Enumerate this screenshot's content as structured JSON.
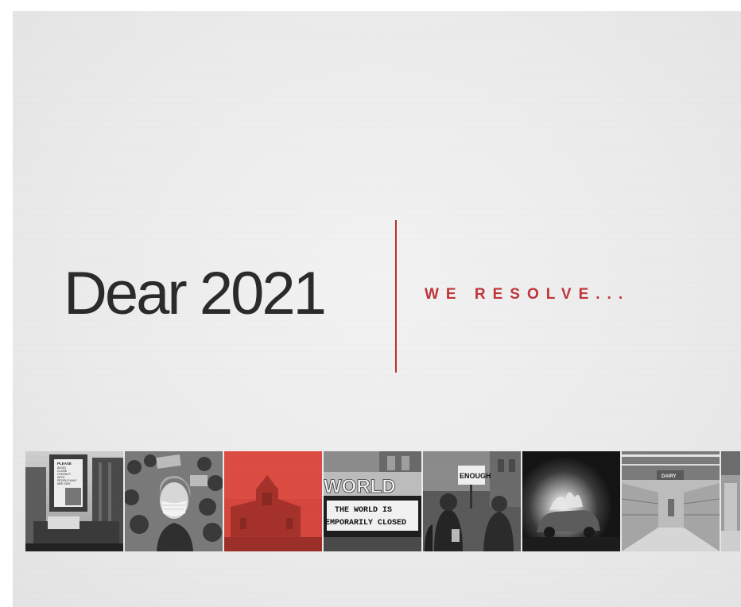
{
  "headline": "Dear 2021",
  "subheadline": "WE RESOLVE...",
  "colors": {
    "accent": "#c0353a",
    "divider": "#b8312f",
    "headline": "#2b2b2b",
    "background": "#ececec"
  },
  "photo_strip": {
    "tiles": [
      {
        "scene": "city-billboard",
        "sign_lines": [
          "PLEASE",
          "AVOID",
          "CLOSE",
          "CONTACT",
          "WITH",
          "PEOPLE WHO",
          "ARE SICK"
        ]
      },
      {
        "scene": "masked-protest-crowd"
      },
      {
        "scene": "red-church-steeple"
      },
      {
        "scene": "theater-marquee",
        "marquee_top": "WORLD",
        "marquee_lines": [
          "THE WORLD IS",
          "TEMPORARILY CLOSED"
        ]
      },
      {
        "scene": "protest-sign",
        "sign_text": "ENOUGH"
      },
      {
        "scene": "burning-car-night"
      },
      {
        "scene": "empty-grocery-aisle",
        "sign_text": "DAIRY"
      },
      {
        "scene": "partial-tile"
      }
    ]
  }
}
